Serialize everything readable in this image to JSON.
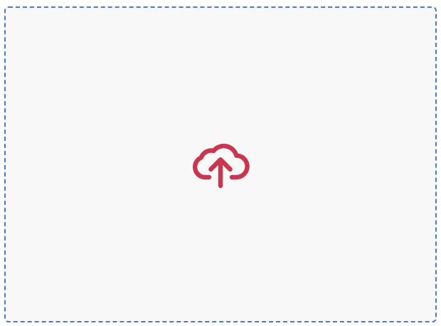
{
  "dropzone": {
    "icon": "cloud-upload-icon",
    "border_color": "#4a7bc8",
    "background_color": "#f8f8f8",
    "icon_color": "#c8374f"
  }
}
